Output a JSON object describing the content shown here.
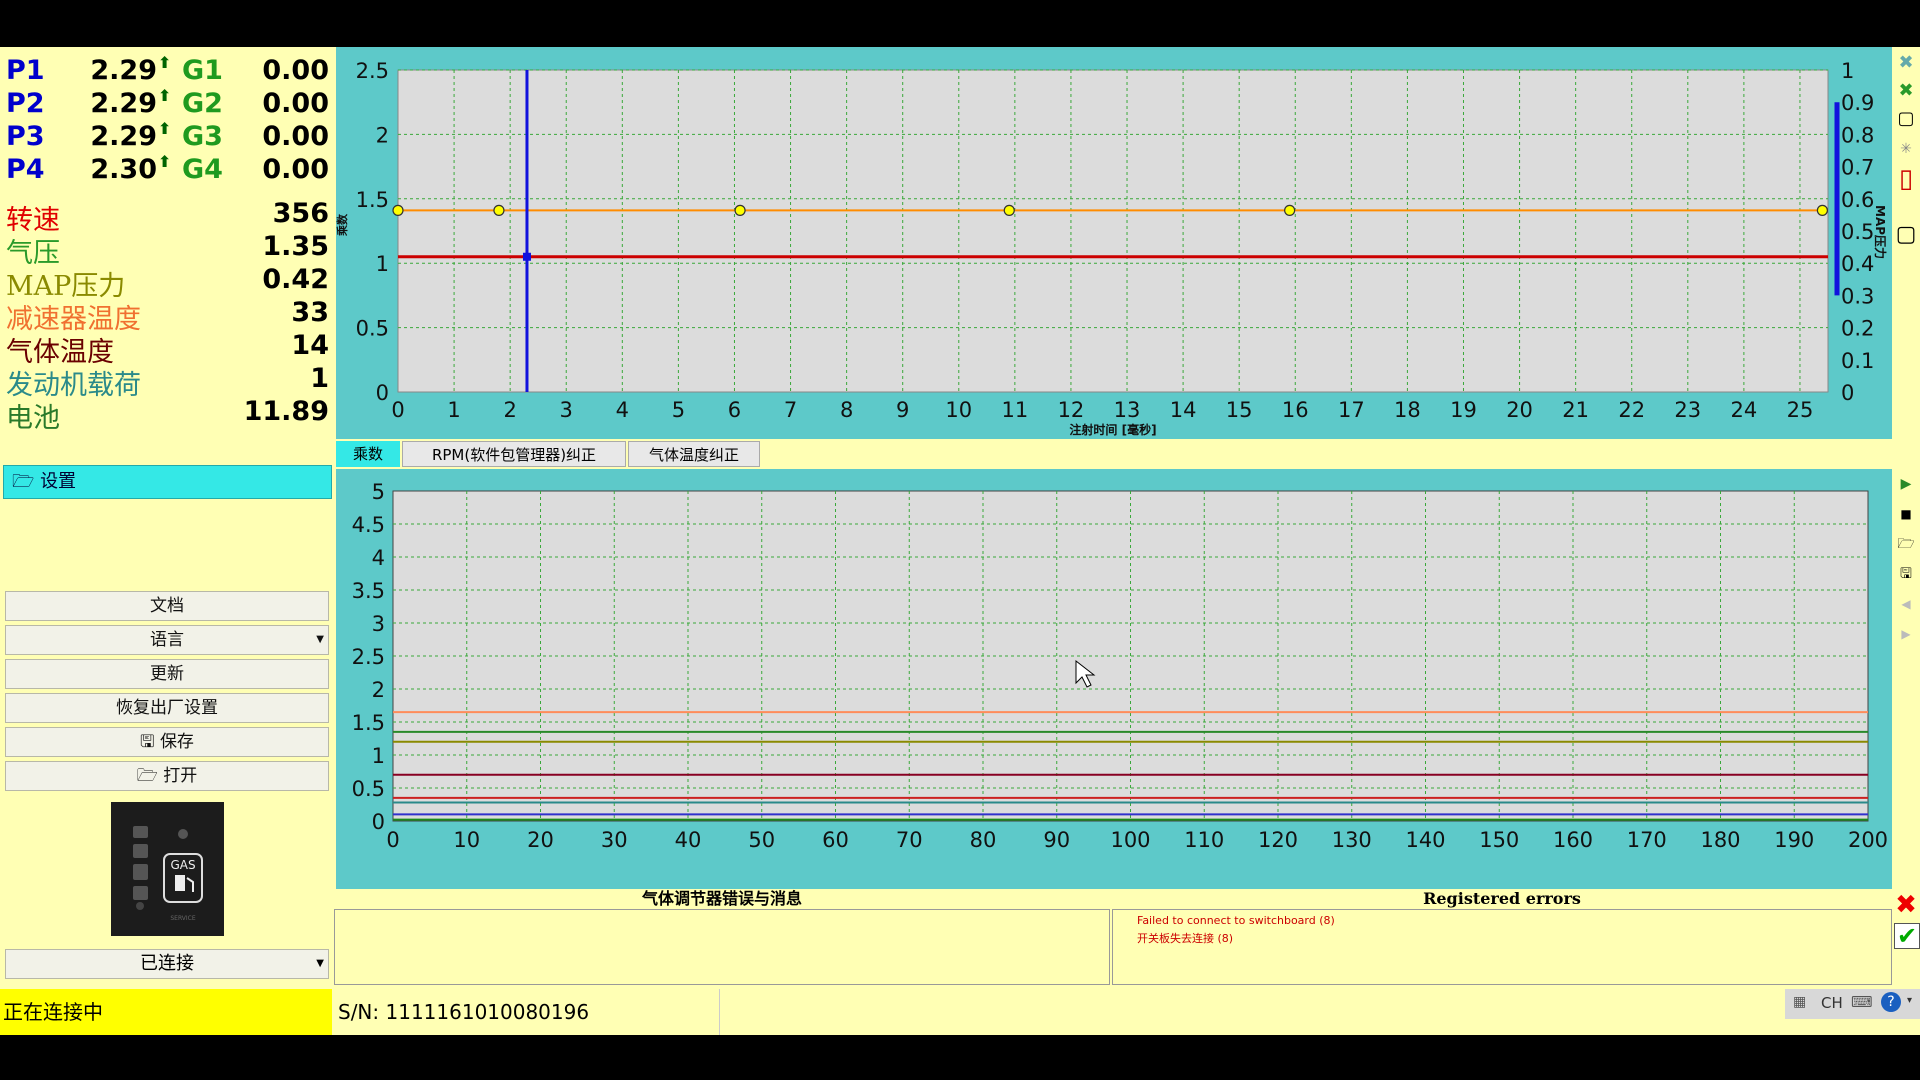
{
  "params": [
    {
      "p": "P1",
      "pv": "2.29",
      "g": "G1",
      "gv": "0.00"
    },
    {
      "p": "P2",
      "pv": "2.29",
      "g": "G2",
      "gv": "0.00"
    },
    {
      "p": "P3",
      "pv": "2.29",
      "g": "G3",
      "gv": "0.00"
    },
    {
      "p": "P4",
      "pv": "2.30",
      "g": "G4",
      "gv": "0.00"
    }
  ],
  "sensors": [
    {
      "label": "转速",
      "value": "356",
      "color": "#e00000"
    },
    {
      "label": "气压",
      "value": "1.35",
      "color": "#2a9a2a"
    },
    {
      "label": "MAP压力",
      "value": "0.42",
      "color": "#8a8a00"
    },
    {
      "label": "减速器温度",
      "value": "33",
      "color": "#f07030"
    },
    {
      "label": "气体温度",
      "value": "14",
      "color": "#6a0000"
    },
    {
      "label": "发动机载荷",
      "value": "1",
      "color": "#2a8a8a"
    },
    {
      "label": "电池",
      "value": "11.89",
      "color": "#2a7a2a"
    }
  ],
  "settings_header": "设置",
  "menu": {
    "docs": "文档",
    "language": "语言",
    "update": "更新",
    "factory_reset": "恢复出厂设置",
    "save": "保存",
    "open": "打开"
  },
  "gas_badge": {
    "text": "GAS",
    "sub": "SERVICE"
  },
  "connection_select": "已连接",
  "tabs": [
    "乘数",
    "RPM(软件包管理器)纠正",
    "气体温度纠正"
  ],
  "messages": {
    "left_title": "气体调节器错误与消息",
    "right_title": "Registered errors",
    "errors": [
      "Failed to connect to switchboard (8)",
      "开关板失去连接 (8)"
    ]
  },
  "status": {
    "connecting": "正在连接中",
    "serial": "S/N: 1111161010080196",
    "tray_lang": "CH"
  },
  "colors": {
    "panel_bg": "#ffffb4",
    "chart_bg": "#5dc9c9",
    "plot_bg": "#dcdcdc",
    "accent": "#34e8e6"
  },
  "chart_data": [
    {
      "type": "line",
      "xlabel": "注射时间 [毫秒]",
      "ylabel": "乘数",
      "y2label": "MAP压力",
      "xlim": [
        0,
        25.5
      ],
      "ylim": [
        0,
        2.5
      ],
      "y2lim": [
        0,
        1
      ],
      "xticks": [
        0,
        1,
        2,
        3,
        4,
        5,
        6,
        7,
        8,
        9,
        10,
        11,
        12,
        13,
        14,
        15,
        16,
        17,
        18,
        19,
        20,
        21,
        22,
        23,
        24,
        25
      ],
      "yticks": [
        "0",
        "0.5",
        "1",
        "1.5",
        "2",
        "2.5"
      ],
      "y2ticks": [
        "0",
        "0.1",
        "0.2",
        "0.3",
        "0.4",
        "0.5",
        "0.6",
        "0.7",
        "0.8",
        "0.9",
        "1"
      ],
      "grid": true,
      "series": [
        {
          "color": "#ff8c00",
          "x": [
            0,
            1.8,
            6.1,
            10.9,
            15.9,
            25.4
          ],
          "y": [
            1.41,
            1.41,
            1.41,
            1.41,
            1.41,
            1.41
          ],
          "markers": true
        },
        {
          "color": "#cc0000",
          "x": [
            0,
            25.5
          ],
          "y": [
            1.05,
            1.05
          ],
          "markers": false
        }
      ],
      "cursor_x": 2.3,
      "cursor_point": {
        "x": 2.3,
        "y": 1.05
      },
      "map_level": [
        0.3,
        0.9
      ]
    },
    {
      "type": "line",
      "xlim": [
        0,
        200
      ],
      "ylim": [
        0,
        5
      ],
      "xticks": [
        0,
        10,
        20,
        30,
        40,
        50,
        60,
        70,
        80,
        90,
        100,
        110,
        120,
        130,
        140,
        150,
        160,
        170,
        180,
        190,
        200
      ],
      "yticks": [
        "0",
        "0.5",
        "1",
        "1.5",
        "2",
        "2.5",
        "3",
        "3.5",
        "4",
        "4.5",
        "5"
      ],
      "grid": true,
      "series": [
        {
          "color": "#ff8c5a",
          "level": 1.65
        },
        {
          "color": "#2a8a2a",
          "level": 1.35
        },
        {
          "color": "#8a8a00",
          "level": 1.2
        },
        {
          "color": "#880022",
          "level": 0.7
        },
        {
          "color": "#cc2020",
          "level": 0.35
        },
        {
          "color": "#2a8a8a",
          "level": 0.28
        },
        {
          "color": "#3030cc",
          "level": 0.1
        },
        {
          "color": "#1a8a1a",
          "level": 0.02
        }
      ]
    }
  ]
}
